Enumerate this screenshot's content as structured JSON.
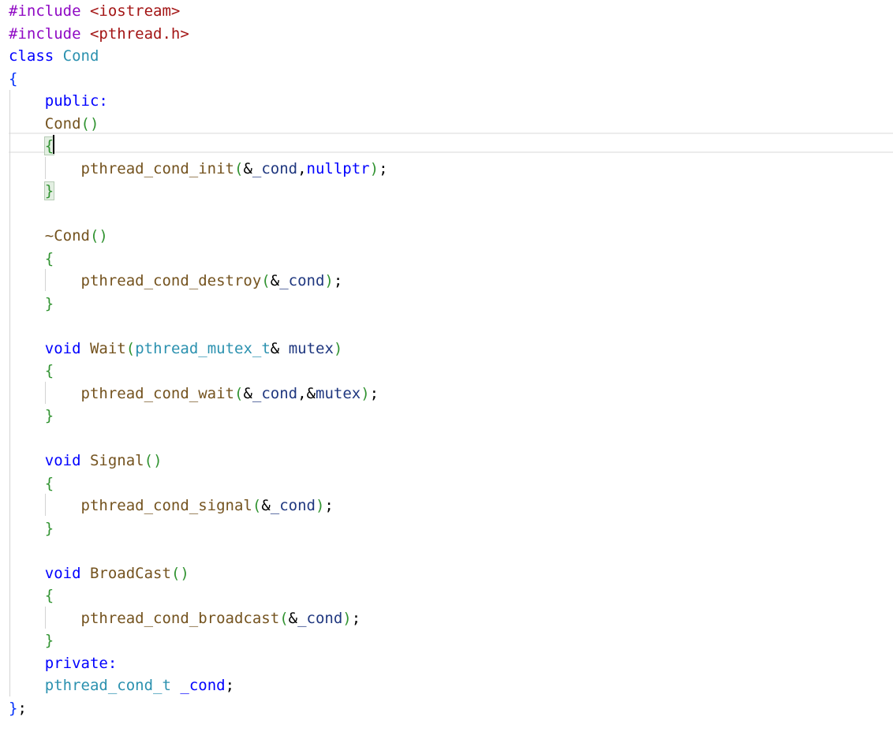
{
  "editor": {
    "lines": [
      [
        {
          "t": "#include",
          "c": "pp"
        },
        {
          "t": " "
        },
        {
          "t": "<iostream>",
          "c": "str"
        }
      ],
      [
        {
          "t": "#include",
          "c": "pp"
        },
        {
          "t": " "
        },
        {
          "t": "<pthread.h>",
          "c": "str"
        }
      ],
      [
        {
          "t": "class",
          "c": "kw"
        },
        {
          "t": " "
        },
        {
          "t": "Cond",
          "c": "ty"
        }
      ],
      [
        {
          "t": "{",
          "c": "bb"
        }
      ],
      [
        {
          "t": "    "
        },
        {
          "t": "public:",
          "c": "kw"
        }
      ],
      [
        {
          "t": "    "
        },
        {
          "t": "Cond",
          "c": "fn"
        },
        {
          "t": "()",
          "c": "br"
        }
      ],
      [
        {
          "t": "    "
        },
        {
          "t": "{",
          "c": "br",
          "m": true
        }
      ],
      [
        {
          "t": "        "
        },
        {
          "t": "pthread_cond_init",
          "c": "fn"
        },
        {
          "t": "(",
          "c": "br"
        },
        {
          "t": "&",
          "c": "pn"
        },
        {
          "t": "_cond",
          "c": "vr"
        },
        {
          "t": ",",
          "c": "pn"
        },
        {
          "t": "nullptr",
          "c": "kw"
        },
        {
          "t": ")",
          "c": "br"
        },
        {
          "t": ";",
          "c": "pn"
        }
      ],
      [
        {
          "t": "    "
        },
        {
          "t": "}",
          "c": "br",
          "m": true
        }
      ],
      [
        {
          "t": ""
        }
      ],
      [
        {
          "t": "    "
        },
        {
          "t": "~Cond",
          "c": "fn"
        },
        {
          "t": "()",
          "c": "br"
        }
      ],
      [
        {
          "t": "    "
        },
        {
          "t": "{",
          "c": "br"
        }
      ],
      [
        {
          "t": "        "
        },
        {
          "t": "pthread_cond_destroy",
          "c": "fn"
        },
        {
          "t": "(",
          "c": "br"
        },
        {
          "t": "&",
          "c": "pn"
        },
        {
          "t": "_cond",
          "c": "vr"
        },
        {
          "t": ")",
          "c": "br"
        },
        {
          "t": ";",
          "c": "pn"
        }
      ],
      [
        {
          "t": "    "
        },
        {
          "t": "}",
          "c": "br"
        }
      ],
      [
        {
          "t": ""
        }
      ],
      [
        {
          "t": "    "
        },
        {
          "t": "void",
          "c": "kw"
        },
        {
          "t": " "
        },
        {
          "t": "Wait",
          "c": "fn"
        },
        {
          "t": "(",
          "c": "br"
        },
        {
          "t": "pthread_mutex_t",
          "c": "ty"
        },
        {
          "t": "&",
          "c": "pn"
        },
        {
          "t": " "
        },
        {
          "t": "mutex",
          "c": "vr"
        },
        {
          "t": ")",
          "c": "br"
        }
      ],
      [
        {
          "t": "    "
        },
        {
          "t": "{",
          "c": "br"
        }
      ],
      [
        {
          "t": "        "
        },
        {
          "t": "pthread_cond_wait",
          "c": "fn"
        },
        {
          "t": "(",
          "c": "br"
        },
        {
          "t": "&",
          "c": "pn"
        },
        {
          "t": "_cond",
          "c": "vr"
        },
        {
          "t": ",",
          "c": "pn"
        },
        {
          "t": "&",
          "c": "pn"
        },
        {
          "t": "mutex",
          "c": "vr"
        },
        {
          "t": ")",
          "c": "br"
        },
        {
          "t": ";",
          "c": "pn"
        }
      ],
      [
        {
          "t": "    "
        },
        {
          "t": "}",
          "c": "br"
        }
      ],
      [
        {
          "t": ""
        }
      ],
      [
        {
          "t": "    "
        },
        {
          "t": "void",
          "c": "kw"
        },
        {
          "t": " "
        },
        {
          "t": "Signal",
          "c": "fn"
        },
        {
          "t": "()",
          "c": "br"
        }
      ],
      [
        {
          "t": "    "
        },
        {
          "t": "{",
          "c": "br"
        }
      ],
      [
        {
          "t": "        "
        },
        {
          "t": "pthread_cond_signal",
          "c": "fn"
        },
        {
          "t": "(",
          "c": "br"
        },
        {
          "t": "&",
          "c": "pn"
        },
        {
          "t": "_cond",
          "c": "vr"
        },
        {
          "t": ")",
          "c": "br"
        },
        {
          "t": ";",
          "c": "pn"
        }
      ],
      [
        {
          "t": "    "
        },
        {
          "t": "}",
          "c": "br"
        }
      ],
      [
        {
          "t": ""
        }
      ],
      [
        {
          "t": "    "
        },
        {
          "t": "void",
          "c": "kw"
        },
        {
          "t": " "
        },
        {
          "t": "BroadCast",
          "c": "fn"
        },
        {
          "t": "()",
          "c": "br"
        }
      ],
      [
        {
          "t": "    "
        },
        {
          "t": "{",
          "c": "br"
        }
      ],
      [
        {
          "t": "        "
        },
        {
          "t": "pthread_cond_broadcast",
          "c": "fn"
        },
        {
          "t": "(",
          "c": "br"
        },
        {
          "t": "&",
          "c": "pn"
        },
        {
          "t": "_cond",
          "c": "vr"
        },
        {
          "t": ")",
          "c": "br"
        },
        {
          "t": ";",
          "c": "pn"
        }
      ],
      [
        {
          "t": "    "
        },
        {
          "t": "}",
          "c": "br"
        }
      ],
      [
        {
          "t": "    "
        },
        {
          "t": "private:",
          "c": "kw"
        }
      ],
      [
        {
          "t": "    "
        },
        {
          "t": "pthread_cond_t",
          "c": "ty"
        },
        {
          "t": " "
        },
        {
          "t": "_cond",
          "c": "mv"
        },
        {
          "t": ";",
          "c": "pn"
        }
      ],
      [
        {
          "t": "}",
          "c": "bb"
        },
        {
          "t": ";",
          "c": "pn"
        }
      ]
    ]
  }
}
